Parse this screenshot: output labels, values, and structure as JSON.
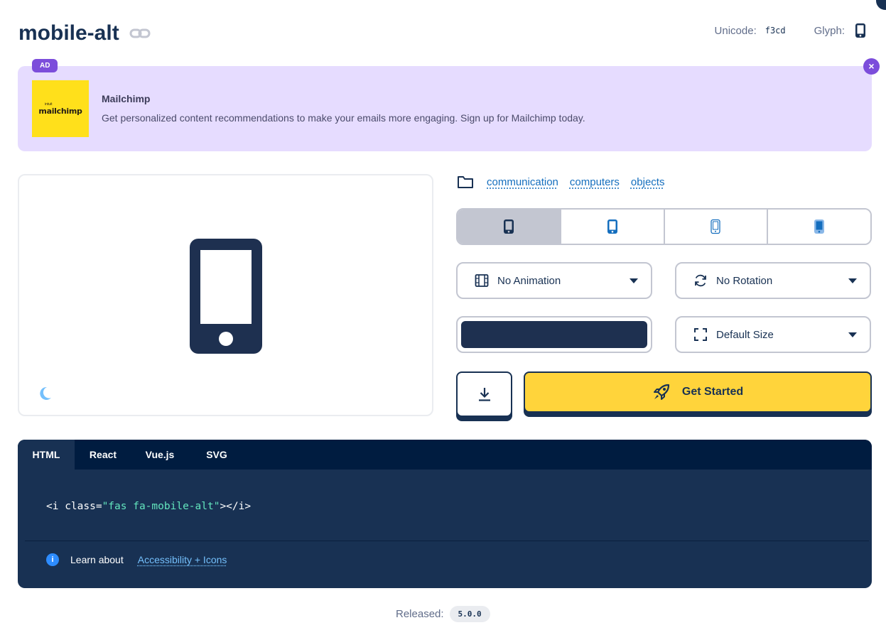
{
  "header": {
    "title": "mobile-alt",
    "unicode_label": "Unicode:",
    "unicode_value": "f3cd",
    "glyph_label": "Glyph:"
  },
  "ad": {
    "badge": "AD",
    "close": "×",
    "logo_small": "intuit",
    "logo_brand": "mailchimp",
    "name": "Mailchimp",
    "text": "Get personalized content recommendations to make your emails more engaging. Sign up for Mailchimp today."
  },
  "categories": [
    "communication",
    "computers",
    "objects"
  ],
  "styles": [
    {
      "name": "solid",
      "active": true
    },
    {
      "name": "regular",
      "active": false
    },
    {
      "name": "light",
      "active": false
    },
    {
      "name": "duotone",
      "active": false
    }
  ],
  "controls": {
    "animation": "No Animation",
    "rotation": "No Rotation",
    "size": "Default Size",
    "color": "#1e3050"
  },
  "buttons": {
    "get_started": "Get Started"
  },
  "code": {
    "tabs": [
      "HTML",
      "React",
      "Vue.js",
      "SVG"
    ],
    "active_tab": "HTML",
    "snippet_pre": "<i class=",
    "snippet_str": "\"fas fa-mobile-alt\"",
    "snippet_post": "></i>",
    "info_icon": "i",
    "learn_label": "Learn about",
    "learn_link": "Accessibility + Icons"
  },
  "footer": {
    "released_label": "Released:",
    "version": "5.0.0"
  },
  "icons": {
    "title_link": "link-icon",
    "glyph": "mobile-alt-icon",
    "preview": "mobile-alt-icon",
    "theme": "moon-icon",
    "folder": "folder-icon",
    "animation": "film-icon",
    "rotation": "sync-icon",
    "size": "expand-icon",
    "download": "download-icon",
    "rocket": "rocket-icon"
  },
  "colors": {
    "primary": "#183153",
    "accent_yellow": "#ffd43b",
    "ad_bg": "#e6dcff",
    "ad_accent": "#7c4ddb",
    "link": "#146ebe",
    "code_string": "#63e6be"
  }
}
